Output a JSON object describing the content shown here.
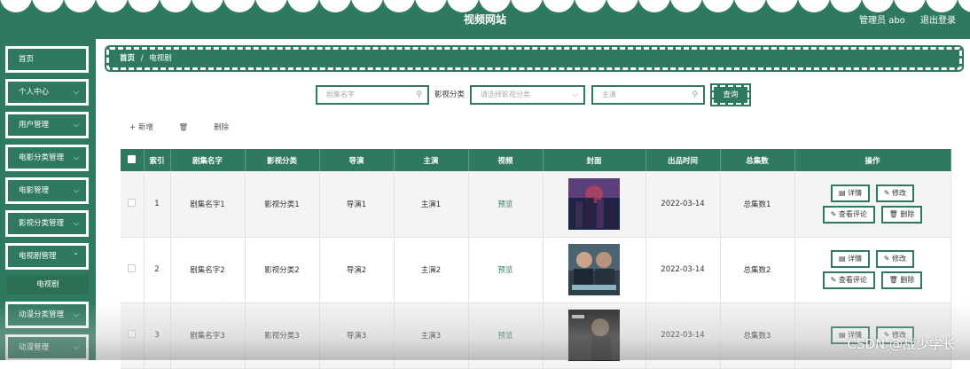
{
  "header": {
    "title": "视频网站",
    "user": "管理员 abo",
    "logout": "退出登录"
  },
  "sidebar": {
    "items": [
      {
        "label": "首页",
        "has_chevron": false
      },
      {
        "label": "个人中心",
        "has_chevron": true
      },
      {
        "label": "用户管理",
        "has_chevron": true
      },
      {
        "label": "电影分类管理",
        "has_chevron": true
      },
      {
        "label": "电影管理",
        "has_chevron": true
      },
      {
        "label": "影视分类管理",
        "has_chevron": true
      },
      {
        "label": "电视剧管理",
        "has_chevron": true
      },
      {
        "label": "动漫分类管理",
        "has_chevron": true
      },
      {
        "label": "动漫管理",
        "has_chevron": true
      }
    ],
    "active_sub": "电视剧"
  },
  "breadcrumb": {
    "home": "首页",
    "sep": "/",
    "current": "电视剧"
  },
  "search": {
    "name_placeholder": "剧集名字",
    "category_label": "影视分类",
    "category_placeholder": "请选择影视分类",
    "actor_placeholder": "主演",
    "button": "查询"
  },
  "actions": {
    "add": "+ 新增",
    "delete": "删除"
  },
  "table": {
    "headers": [
      "",
      "索引",
      "剧集名字",
      "影视分类",
      "导演",
      "主演",
      "视频",
      "封面",
      "出品时间",
      "总集数",
      "操作"
    ],
    "rows": [
      {
        "index": "1",
        "name": "剧集名字1",
        "category": "影视分类1",
        "director": "导演1",
        "actor": "主演1",
        "video": "预览",
        "date": "2022-03-14",
        "episodes": "总集数1"
      },
      {
        "index": "2",
        "name": "剧集名字2",
        "category": "影视分类2",
        "director": "导演2",
        "actor": "主演2",
        "video": "预览",
        "date": "2022-03-14",
        "episodes": "总集数2"
      },
      {
        "index": "3",
        "name": "剧集名字3",
        "category": "影视分类3",
        "director": "导演3",
        "actor": "主演3",
        "video": "预览",
        "date": "2022-03-14",
        "episodes": "总集数3"
      }
    ],
    "row_buttons": {
      "detail": "详情",
      "edit": "修改",
      "comments": "查看评论",
      "delete": "删除"
    }
  },
  "watermark": "CSDN @战少学长",
  "colors": {
    "primary": "#2f7a5e",
    "header_text": "#ffffff"
  }
}
